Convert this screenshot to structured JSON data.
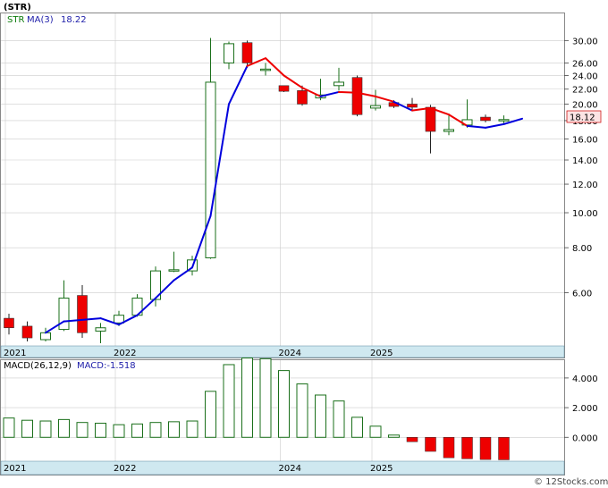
{
  "header": {
    "symbol": "(STR)",
    "legend_symbol": "STR",
    "legend_ma": "MA(3)",
    "legend_ma_value": "18.22",
    "last_price_label": "18.12"
  },
  "macd_header": {
    "label": "MACD(26,12,9)",
    "value_label": "MACD:-1.518"
  },
  "watermark": "© 12Stocks.com",
  "colors": {
    "up_candle": "#1a6f1a",
    "down_candle": "#ee0000",
    "ma_rising": "#0000dd",
    "ma_falling": "#ee0000",
    "macd_positive": "#1a6f1a",
    "macd_negative": "#ee0000",
    "time_bar": "#cfe8f0",
    "grid": "#cccccc",
    "legend_text": "#2020aa"
  },
  "chart_data": [
    {
      "type": "candlestick",
      "title": "(STR)",
      "y_scale": "log",
      "ylim": [
        4.35,
        33.5
      ],
      "y_ticks": [
        {
          "value": 30,
          "label": "30.00"
        },
        {
          "value": 26,
          "label": "26.00"
        },
        {
          "value": 24,
          "label": "24.00"
        },
        {
          "value": 22,
          "label": "22.00"
        },
        {
          "value": 20,
          "label": "20.00"
        },
        {
          "value": 18,
          "label": "18.00"
        },
        {
          "value": 16,
          "label": "16.00"
        },
        {
          "value": 14,
          "label": "14.00"
        },
        {
          "value": 12,
          "label": "12.00"
        },
        {
          "value": 10,
          "label": "10.00"
        },
        {
          "value": 8,
          "label": "8.00"
        },
        {
          "value": 6,
          "label": "6.00"
        }
      ],
      "x_ticks": [
        {
          "index": 0,
          "label": "2021"
        },
        {
          "index": 6,
          "label": "2022"
        },
        {
          "index": 15,
          "label": "2024"
        },
        {
          "index": 20,
          "label": "2025"
        }
      ],
      "grid": true,
      "last_price": 18.12,
      "candles": [
        {
          "o": 5.1,
          "h": 5.25,
          "l": 4.6,
          "c": 4.8
        },
        {
          "o": 4.85,
          "h": 5.0,
          "l": 4.4,
          "c": 4.5
        },
        {
          "o": 4.45,
          "h": 4.8,
          "l": 4.4,
          "c": 4.65
        },
        {
          "o": 4.75,
          "h": 6.5,
          "l": 4.7,
          "c": 5.8
        },
        {
          "o": 5.9,
          "h": 6.3,
          "l": 4.5,
          "c": 4.65
        },
        {
          "o": 4.7,
          "h": 4.95,
          "l": 4.35,
          "c": 4.8
        },
        {
          "o": 4.95,
          "h": 5.35,
          "l": 4.85,
          "c": 5.2
        },
        {
          "o": 5.2,
          "h": 5.95,
          "l": 5.15,
          "c": 5.8
        },
        {
          "o": 5.75,
          "h": 7.1,
          "l": 5.5,
          "c": 6.9
        },
        {
          "o": 6.9,
          "h": 7.8,
          "l": 6.85,
          "c": 6.95
        },
        {
          "o": 6.9,
          "h": 7.6,
          "l": 6.7,
          "c": 7.4
        },
        {
          "o": 7.5,
          "h": 30.5,
          "l": 7.45,
          "c": 23.0
        },
        {
          "o": 26.0,
          "h": 29.8,
          "l": 25.0,
          "c": 29.4
        },
        {
          "o": 29.6,
          "h": 30.0,
          "l": 25.2,
          "c": 26.0
        },
        {
          "o": 25.0,
          "h": 26.0,
          "l": 24.0,
          "c": 25.0
        },
        {
          "o": 22.5,
          "h": 22.5,
          "l": 21.6,
          "c": 21.7
        },
        {
          "o": 21.8,
          "h": 22.5,
          "l": 19.8,
          "c": 20.0
        },
        {
          "o": 20.8,
          "h": 23.5,
          "l": 20.5,
          "c": 21.2
        },
        {
          "o": 22.5,
          "h": 25.2,
          "l": 21.8,
          "c": 23.0
        },
        {
          "o": 23.7,
          "h": 24.0,
          "l": 18.5,
          "c": 18.7
        },
        {
          "o": 19.5,
          "h": 21.9,
          "l": 19.2,
          "c": 19.8
        },
        {
          "o": 20.2,
          "h": 20.5,
          "l": 19.5,
          "c": 19.7
        },
        {
          "o": 20.0,
          "h": 20.8,
          "l": 19.3,
          "c": 19.6
        },
        {
          "o": 19.6,
          "h": 19.9,
          "l": 14.6,
          "c": 16.8
        },
        {
          "o": 16.8,
          "h": 18.8,
          "l": 16.4,
          "c": 17.0
        },
        {
          "o": 17.5,
          "h": 20.6,
          "l": 17.2,
          "c": 18.1
        },
        {
          "o": 18.4,
          "h": 18.7,
          "l": 17.8,
          "c": 18.0
        },
        {
          "o": 18.0,
          "h": 18.6,
          "l": 17.5,
          "c": 18.12
        }
      ],
      "ma": {
        "name": "MA(3)",
        "start_index": 2,
        "values": [
          4.65,
          5.0,
          5.05,
          5.1,
          4.9,
          5.2,
          5.8,
          6.5,
          7.05,
          9.8,
          20.0,
          25.5,
          26.8,
          24.0,
          22.2,
          21.0,
          21.6,
          21.5,
          21.0,
          20.3,
          19.2,
          19.5,
          18.7,
          17.4,
          17.2,
          17.6,
          18.22
        ],
        "colors": [
          "r",
          "r",
          "r",
          "r",
          "r",
          "r",
          "r",
          "r",
          "r",
          "r",
          "r",
          "r",
          "f",
          "f",
          "f",
          "f",
          "r",
          "f",
          "f",
          "f",
          "r",
          "f",
          "f",
          "f",
          "r",
          "r",
          "r"
        ]
      }
    },
    {
      "type": "bar",
      "title": "MACD(26,12,9)",
      "ylim": [
        -1.55,
        5.2
      ],
      "y_ticks": [
        {
          "value": 4,
          "label": "4.000"
        },
        {
          "value": 2,
          "label": "2.000"
        },
        {
          "value": 0,
          "label": "0.000"
        }
      ],
      "x_ticks": [
        {
          "index": 0,
          "label": "2021"
        },
        {
          "index": 6,
          "label": "2022"
        },
        {
          "index": 15,
          "label": "2024"
        },
        {
          "index": 20,
          "label": "2025"
        }
      ],
      "values": [
        1.3,
        1.15,
        1.1,
        1.2,
        1.0,
        0.95,
        0.85,
        0.9,
        1.0,
        1.05,
        1.1,
        3.1,
        4.9,
        5.35,
        5.3,
        4.5,
        3.6,
        2.85,
        2.45,
        1.35,
        0.75,
        0.15,
        -0.3,
        -0.95,
        -1.38,
        -1.45,
        -1.5,
        -1.518
      ],
      "last_value": -1.518
    }
  ]
}
